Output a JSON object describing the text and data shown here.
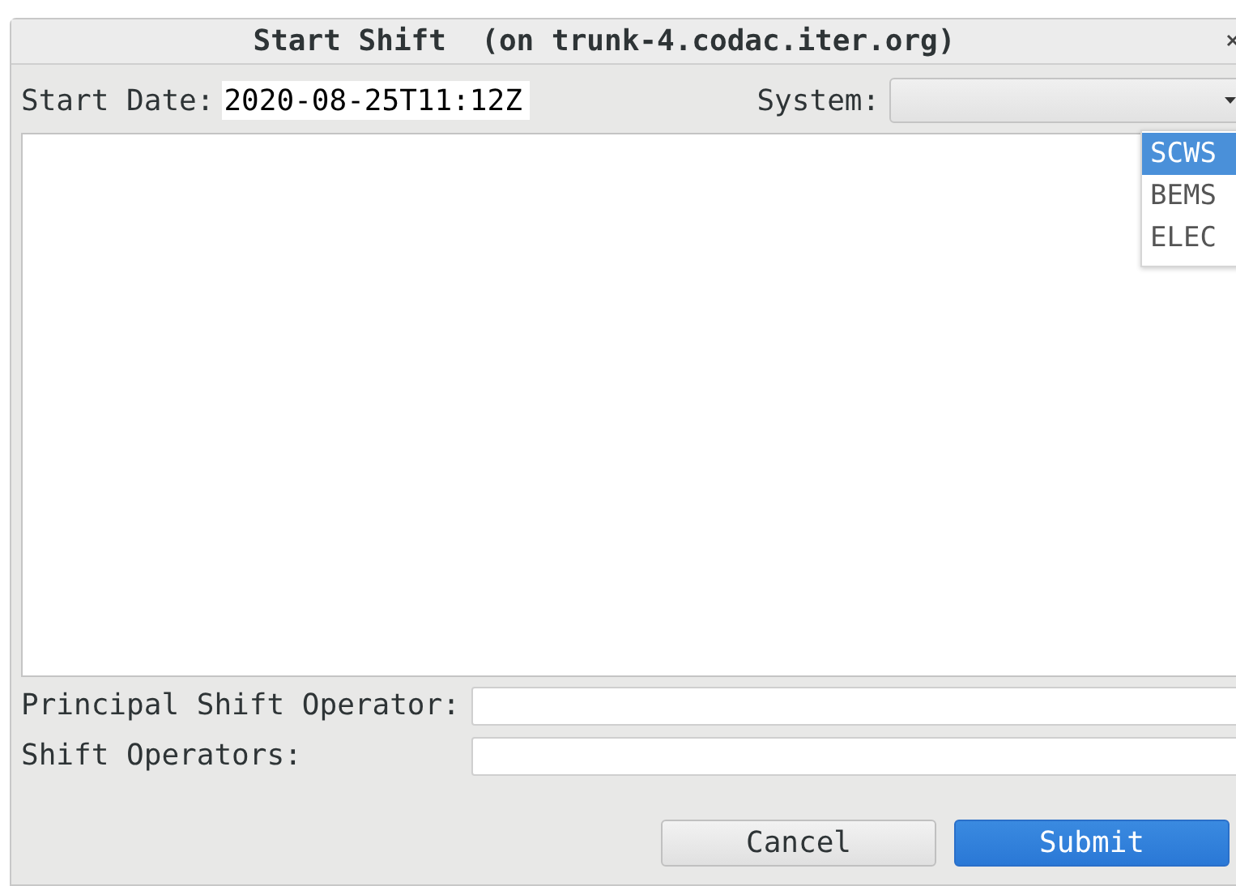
{
  "window": {
    "title": "Start Shift  (on trunk-4.codac.iter.org)"
  },
  "start_date": {
    "label": "Start Date:",
    "value": "2020-08-25T11:12Z"
  },
  "system": {
    "label": "System:",
    "expanded": true,
    "options": [
      {
        "label": "SCWS",
        "selected": true
      },
      {
        "label": "BEMS",
        "selected": false
      },
      {
        "label": "ELEC",
        "selected": false
      }
    ]
  },
  "principal_shift_operator": {
    "label": "Principal Shift Operator:"
  },
  "shift_operators": {
    "label": "Shift Operators:"
  },
  "buttons": [
    {
      "label": "Cancel",
      "kind": "secondary"
    },
    {
      "label": "Submit",
      "kind": "primary"
    }
  ]
}
